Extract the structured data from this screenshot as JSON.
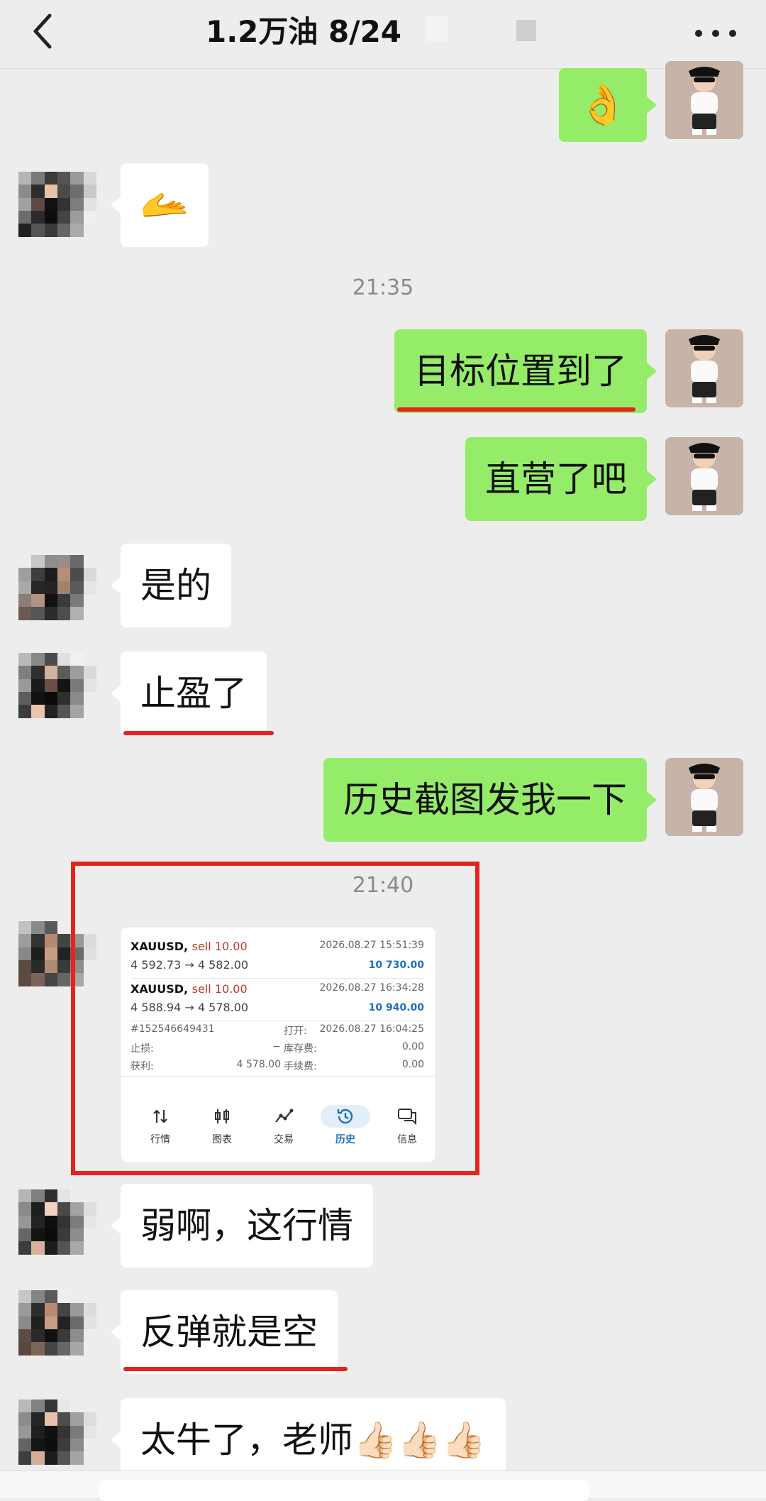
{
  "header": {
    "title": "1.2万油  8/24",
    "back_icon": "chevron-left-icon",
    "more_icon": "more-dots-icon"
  },
  "messages": [
    {
      "side": "me",
      "content": "👌",
      "kind": "emoji"
    },
    {
      "side": "them",
      "content": "🫴",
      "kind": "emoji"
    },
    {
      "time": "21:35"
    },
    {
      "side": "me",
      "content": "目标位置到了",
      "underlined": true
    },
    {
      "side": "me",
      "content": "直营了吧"
    },
    {
      "side": "them",
      "content": "是的"
    },
    {
      "side": "them",
      "content": "止盈了",
      "underlined": true
    },
    {
      "side": "me",
      "content": "历史截图发我一下"
    },
    {
      "time": "21:40"
    },
    {
      "side": "them",
      "kind": "screenshot"
    },
    {
      "side": "them",
      "content": "弱啊，这行情"
    },
    {
      "side": "them",
      "content": "反弹就是空",
      "underlined": true
    },
    {
      "side": "them",
      "content": "太牛了，老师👍🏻👍🏻👍🏻"
    }
  ],
  "screenshot": {
    "trades": [
      {
        "symbol": "XAUUSD,",
        "side": "sell 10.00",
        "prices": "4 592.73 → 4 582.00",
        "datetime": "2026.08.27 15:51:39",
        "profit": "10 730.00"
      },
      {
        "symbol": "XAUUSD,",
        "side": "sell 10.00",
        "prices": "4 588.94 → 4 578.00",
        "datetime": "2026.08.27 16:34:28",
        "profit": "10 940.00"
      }
    ],
    "details": [
      {
        "label": "#152546649431",
        "value": "",
        "label2": "打开:",
        "value2": "2026.08.27 16:04:25"
      },
      {
        "label": "止损:",
        "value": "−",
        "label2": "库存费:",
        "value2": "0.00"
      },
      {
        "label": "获利:",
        "value": "4 578.00",
        "label2": "手续费:",
        "value2": "0.00"
      }
    ],
    "nav": [
      {
        "label": "行情",
        "icon": "arrows-updown-icon"
      },
      {
        "label": "图表",
        "icon": "candlestick-icon"
      },
      {
        "label": "交易",
        "icon": "trend-line-icon"
      },
      {
        "label": "历史",
        "icon": "history-clock-icon",
        "active": true
      },
      {
        "label": "信息",
        "icon": "chat-bubbles-icon"
      }
    ]
  },
  "colors": {
    "my_bubble": "#95ec69",
    "their_bubble": "#ffffff",
    "annotation_red": "#e0261e",
    "background": "#ededed",
    "profit_blue": "#1e6fc2",
    "sell_red": "#c0392b"
  }
}
